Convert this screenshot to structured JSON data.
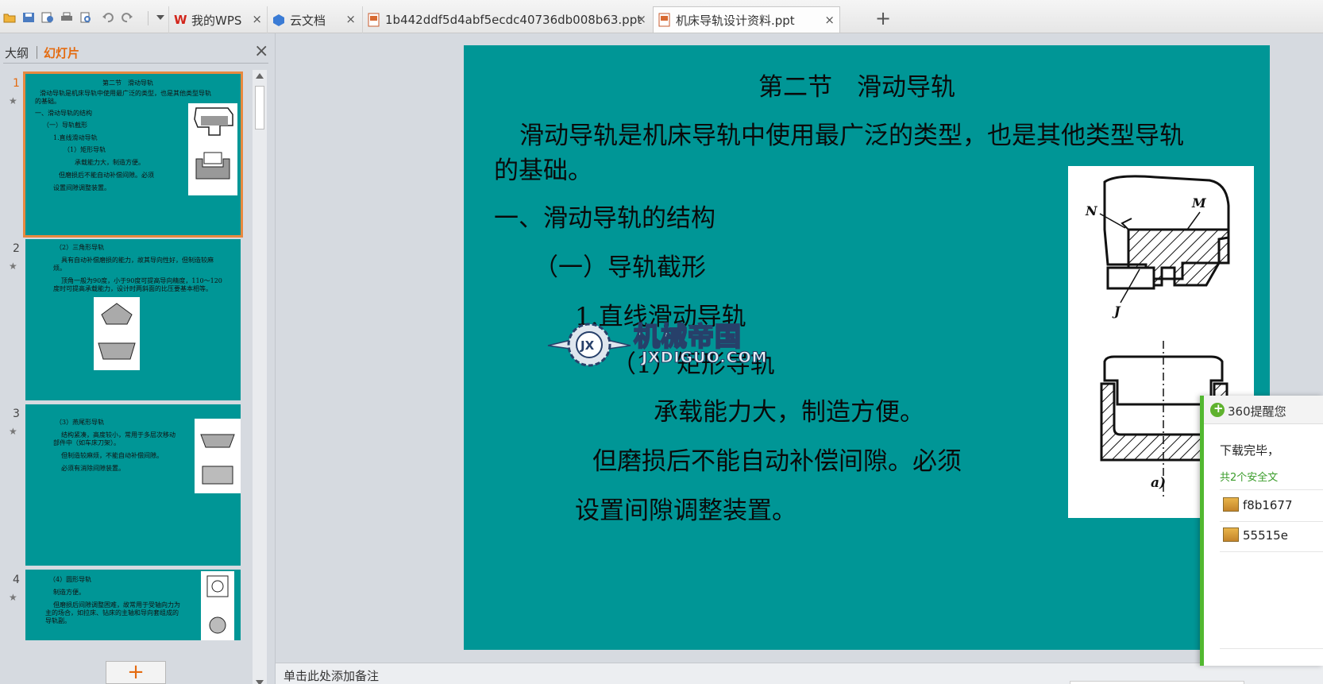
{
  "tabbar": {
    "quick_icons": [
      "open-folder-icon",
      "save-icon",
      "save-as-icon",
      "print-icon",
      "print-preview-icon",
      "undo-icon",
      "redo-icon",
      "dropdown-icon"
    ],
    "tabs": [
      {
        "label": "我的WPS",
        "icon": "wps-logo-icon",
        "active": false
      },
      {
        "label": "云文档",
        "icon": "cloud-docs-icon",
        "active": false
      },
      {
        "label": "1b442ddf5d4abf5ecdc40736db008b63.ppt",
        "icon": "ppt-file-icon",
        "active": false
      },
      {
        "label": "机床导轨设计资料.ppt",
        "icon": "ppt-file-icon",
        "active": true
      }
    ],
    "close_glyph": "×",
    "add_glyph": "+"
  },
  "left_panel": {
    "tab_outline": "大纲",
    "tab_slides": "幻灯片",
    "close_glyph": "×",
    "add_slide_glyph": "+",
    "thumbnails": [
      {
        "number": "1",
        "lines": [
          "第二节　滑动导轨",
          "滑动导轨是机床导轨中使用最广泛的类型，也是其他类型导轨",
          "的基础。",
          "一、滑动导轨的结构",
          "（一）导轨截形",
          "1.直线滑动导轨",
          "（1）矩形导轨",
          "承载能力大，制造方便。",
          "但磨损后不能自动补偿间隙。必须",
          "设置间隙调整装置。"
        ]
      },
      {
        "number": "2",
        "lines": [
          "（2）三角形导轨",
          "具有自动补偿磨损的能力，故其导向性好，但制造较麻",
          "烦。",
          "顶角一般为90度，小于90度可提高导向精度，110～120",
          "度时可提高承载能力，设计时两斜面的比压要基本相等。"
        ]
      },
      {
        "number": "3",
        "lines": [
          "（3）燕尾形导轨",
          "结构紧凑，高度较小，常用于多层次移动",
          "部件中（如车床刀架）。",
          "但制造较麻烦，不能自动补偿间隙。",
          "必须有消除间隙装置。"
        ]
      },
      {
        "number": "4",
        "lines": [
          "（4）圆形导轨",
          "制造方便。",
          "但磨损后间隙调整困难，故常用于受轴向力为",
          "主的场合，如拉床、钻床的主轴和导向套组成的",
          "导轨副。"
        ]
      }
    ],
    "star_glyph": "★"
  },
  "slide": {
    "title": "第二节　滑动导轨",
    "para1_line1": "滑动导轨是机床导轨中使用最广泛的类型，也是其他类型导轨",
    "para1_line2": "的基础。",
    "heading1": "一、滑动导轨的结构",
    "heading2": "（一）导轨截形",
    "heading3": "1.直线滑动导轨",
    "heading4": "（1）矩形导轨",
    "bullet1": "承载能力大，制造方便。",
    "bullet2": "但磨损后不能自动补偿间隙。必须",
    "bullet3": "设置间隙调整装置。",
    "figure_labels": [
      "N",
      "M",
      "J",
      "a)"
    ],
    "watermark_text": "机械帝国",
    "watermark_sub": "JXDIGUO.COM",
    "bg_color": "#009696"
  },
  "notes": {
    "placeholder": "单击此处添加备注"
  },
  "popup": {
    "title": "360提醒您",
    "line1": "下载完毕，",
    "line2": "共2个安全文",
    "files": [
      "f8b1677",
      "55515e"
    ]
  }
}
